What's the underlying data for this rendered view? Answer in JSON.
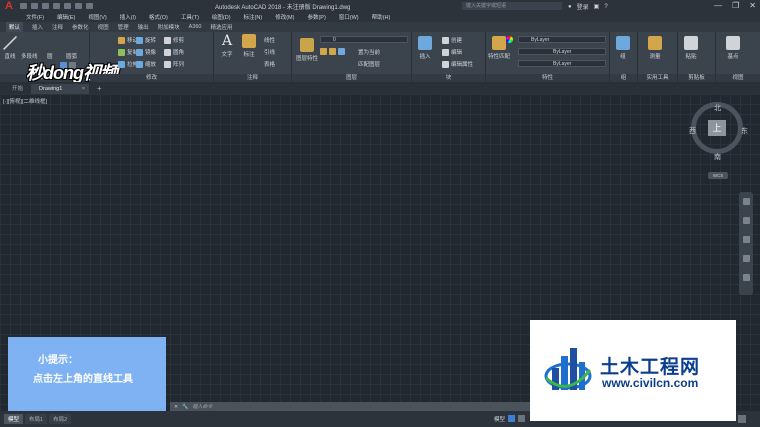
{
  "app": {
    "logo": "A",
    "title": "Autodesk AutoCAD 2018 - 未注册版    Drawing1.dwg",
    "search_placeholder": "键入关键字或短语",
    "login": "登录",
    "window_controls": [
      "—",
      "❐",
      "✕"
    ]
  },
  "menu": [
    "文件(F)",
    "编辑(E)",
    "视图(V)",
    "插入(I)",
    "格式(O)",
    "工具(T)",
    "绘图(D)",
    "标注(N)",
    "修改(M)",
    "参数(P)",
    "窗口(W)",
    "帮助(H)"
  ],
  "ribbon_tabs": [
    "默认",
    "插入",
    "注释",
    "参数化",
    "视图",
    "管理",
    "输出",
    "附加模块",
    "A360",
    "精选应用"
  ],
  "watermark": "秒dong视频",
  "ribbon": {
    "draw": {
      "label": "绘图",
      "line": "直线",
      "polyline": "多段线",
      "circle": "圆",
      "arc": "圆弧"
    },
    "modify": {
      "label": "修改",
      "move": "移动",
      "rotate": "旋转",
      "trim": "修剪",
      "copy": "复制",
      "mirror": "镜像",
      "fillet": "圆角",
      "stretch": "拉伸",
      "scale": "缩放",
      "array": "阵列"
    },
    "annotation": {
      "label": "注释",
      "text": "文字",
      "dimension": "标注",
      "linear": "线性",
      "leader": "引线",
      "table": "表格"
    },
    "layers": {
      "label": "图层",
      "layer_props": "图层特性",
      "current_layer": "0",
      "make_current": "置为当前",
      "match": "匹配图层"
    },
    "block": {
      "label": "块",
      "insert": "插入",
      "create": "创建",
      "edit": "编辑",
      "edit_attr": "编辑属性"
    },
    "properties": {
      "label": "特性",
      "match": "特性匹配",
      "color": "ByLayer",
      "linetype": "ByLayer",
      "lineweight": "ByLayer"
    },
    "groups": {
      "label": "组",
      "group": "组"
    },
    "utilities": {
      "label": "实用工具",
      "measure": "测量"
    },
    "clipboard": {
      "label": "剪贴板",
      "paste": "粘贴"
    },
    "view": {
      "label": "视图",
      "base": "基点"
    }
  },
  "doc_tabs": [
    "开始",
    "Drawing1"
  ],
  "viewport_label": "[-][俯视][二维线框]",
  "viewcube": {
    "top": "上",
    "north": "北",
    "south": "南",
    "west": "西",
    "east": "东",
    "wcs": "WCS"
  },
  "tip": {
    "title": "小提示：",
    "text": "点击左上角的直线工具"
  },
  "site": {
    "name": "土木工程网",
    "url": "www.civilcn.com"
  },
  "command": {
    "placeholder": "键入命令"
  },
  "status": {
    "layout_tabs": [
      "模型",
      "布局1",
      "布局2"
    ],
    "model": "模型"
  },
  "colors": {
    "accent": "#3e7fd6",
    "tip_bg": "#7fb2f2",
    "site_blue": "#0c3e8e",
    "app_red": "#e0302a"
  }
}
